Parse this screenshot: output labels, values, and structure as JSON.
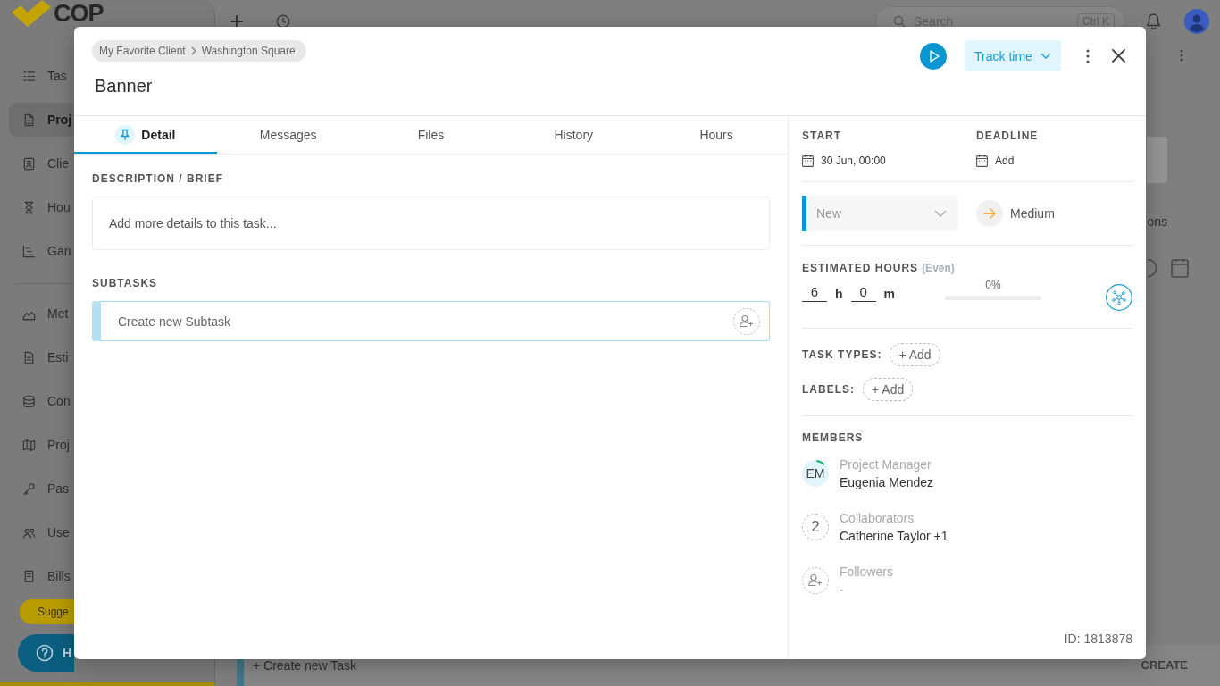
{
  "background": {
    "logo": "COP",
    "sidebar": {
      "groups": [
        {
          "items": [
            {
              "label": "Tas",
              "selected": false
            },
            {
              "label": "Proj",
              "selected": true
            },
            {
              "label": "Clie",
              "selected": false
            },
            {
              "label": "Hou",
              "selected": false
            },
            {
              "label": "Gan",
              "selected": false
            }
          ]
        },
        {
          "items": [
            {
              "label": "Met",
              "selected": false
            },
            {
              "label": "Esti",
              "selected": false
            },
            {
              "label": "Con",
              "selected": false
            },
            {
              "label": "Proj",
              "selected": false
            },
            {
              "label": "Pas",
              "selected": false
            },
            {
              "label": "Use",
              "selected": false
            },
            {
              "label": "Bills",
              "selected": false
            }
          ]
        }
      ],
      "suggest_button": "Sugge",
      "help_button": "H"
    },
    "topbar": {
      "search": {
        "placeholder": "Search",
        "shortcut": "Ctrl K"
      }
    },
    "side_text": "ons",
    "new_task": {
      "placeholder": "+ Create new Task",
      "button": "CREATE"
    }
  },
  "task": {
    "breadcrumb": [
      {
        "label": "My Favorite Client"
      },
      {
        "label": "Washington Square"
      }
    ],
    "title": "Banner",
    "track_button": "Track time",
    "tabs": [
      {
        "label": "Detail",
        "selected": true
      },
      {
        "label": "Messages",
        "selected": false
      },
      {
        "label": "Files",
        "selected": false
      },
      {
        "label": "History",
        "selected": false
      },
      {
        "label": "Hours",
        "selected": false
      }
    ],
    "description": {
      "heading": "DESCRIPTION / BRIEF",
      "placeholder": "Add more details to this task..."
    },
    "subtasks": {
      "heading": "SUBTASKS",
      "placeholder": "Create new Subtask"
    },
    "dates": [
      {
        "label": "START",
        "value": "30 Jun, 00:00"
      },
      {
        "label": "DEADLINE",
        "value": "Add"
      }
    ],
    "status": "New",
    "priority": "Medium",
    "estimate": {
      "heading": "ESTIMATED HOURS",
      "note": "(Even)",
      "hours": "6",
      "hours_unit": "h",
      "minutes": "0",
      "minutes_unit": "m",
      "progress": {
        "reading": "0%"
      }
    },
    "tags": [
      {
        "label": "TASK TYPES:",
        "button": "+ Add"
      },
      {
        "label": "LABELS:",
        "button": "+ Add"
      }
    ],
    "members": {
      "heading": "MEMBERS",
      "items": [
        {
          "kind": "avatar",
          "badge": "EM",
          "role": "Project Manager",
          "name": "Eugenia Mendez"
        },
        {
          "kind": "count",
          "badge": "2",
          "role": "Collaborators",
          "name": "Catherine Taylor +1"
        },
        {
          "kind": "add",
          "role": "Followers",
          "name": "-"
        }
      ]
    },
    "id": "ID: 1813878"
  }
}
